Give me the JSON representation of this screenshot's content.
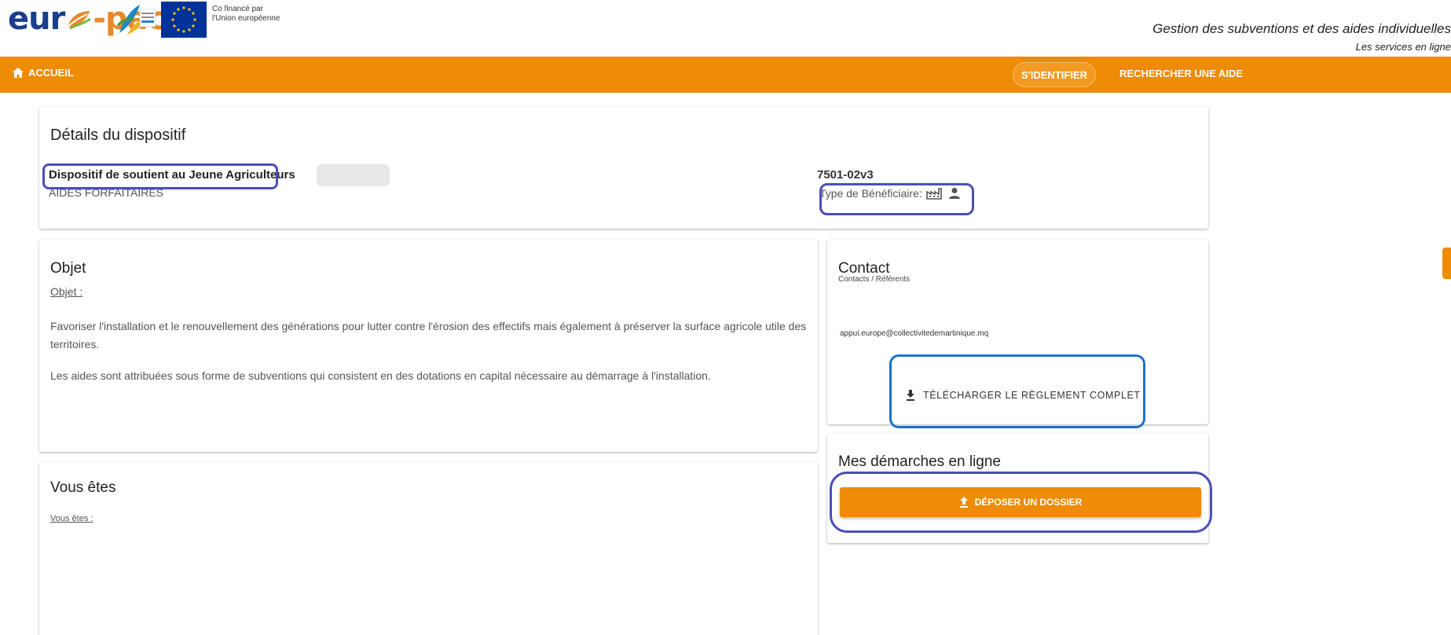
{
  "header": {
    "logo": {
      "part1": "eur",
      "part2": "-pac"
    },
    "eu_caption_line1": "Co financé par",
    "eu_caption_line2": "l'Union européenne",
    "app_title": "Gestion des subventions et des aides individuelles",
    "app_subtitle": "Les services en ligne"
  },
  "nav": {
    "home_label": "ACCUEIL",
    "login_label": "S'IDENTIFIER",
    "search_label": "RECHERCHER UNE AIDE"
  },
  "details": {
    "title": "Détails du dispositif",
    "scheme_name": "Dispositif de soutient au Jeune Agriculteurs",
    "scheme_type": "AIDES FORFAITAIRES",
    "code": "7501-02v3",
    "beneficiary_label": "Type de Bénéficiaire:"
  },
  "objet": {
    "title": "Objet",
    "subtitle": "Objet :",
    "paragraph1": "Favoriser l'installation et le renouvellement des générations pour lutter contre l'érosion des effectifs mais également à préserver la surface agricole utile des territoires.",
    "paragraph2": "Les aides sont attribuées sous forme de subventions qui consistent en des dotations en capital nécessaire au démarrage à l'installation."
  },
  "vous": {
    "title": "Vous êtes",
    "subtitle": "Vous êtes :"
  },
  "contact": {
    "title": "Contact",
    "subtitle": "Contacts / Référents",
    "email": "appui.europe@collectivitedemartinique.mq",
    "download_label": "TÉLÉCHARGER LE RÈGLEMENT COMPLET"
  },
  "demarches": {
    "title": "Mes démarches en ligne",
    "deposit_label": "DÉPOSER UN DOSSIER"
  },
  "colors": {
    "primary_orange": "#ee8b07",
    "logo_blue": "#1a3e8c",
    "highlight_purple": "#4a4fb8",
    "highlight_blue": "#1a73c8"
  }
}
